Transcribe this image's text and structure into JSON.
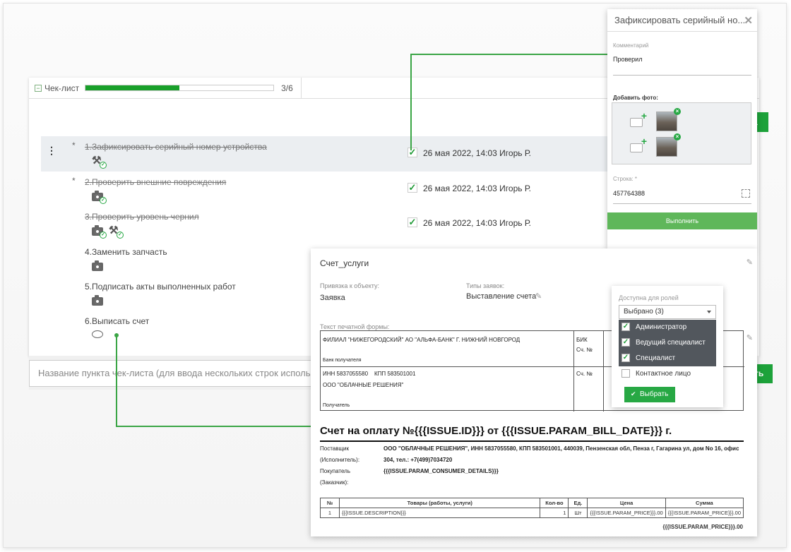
{
  "checklist": {
    "tab_label": "Чек-лист",
    "progress": 0.5,
    "count": "3/6",
    "items": [
      {
        "num": "1.",
        "title": "Зафиксировать серийный номер устройства",
        "done": true,
        "required": true,
        "meta": "26 мая 2022, 14:03 Игорь Р."
      },
      {
        "num": "2.",
        "title": "Проверить внешние повреждения",
        "done": true,
        "required": true,
        "meta": "26 мая 2022, 14:03 Игорь Р."
      },
      {
        "num": "3.",
        "title": "Проверить уровень чернил",
        "done": true,
        "required": false,
        "meta": "26 мая 2022, 14:03 Игорь Р."
      },
      {
        "num": "4.",
        "title": "Заменить запчасть",
        "done": false,
        "required": false,
        "meta": ""
      },
      {
        "num": "5.",
        "title": "Подписать акты выполненных работ",
        "done": false,
        "required": false,
        "meta": ""
      },
      {
        "num": "6.",
        "title": "Выписать счет",
        "done": false,
        "required": false,
        "meta": ""
      }
    ],
    "input_placeholder": "Название пункта чек-листа (для ввода нескольких строк используй",
    "add_button_partial": "ть",
    "top_button_partial": "а"
  },
  "popup_serial": {
    "title": "Зафиксировать серийный но...",
    "comment_label": "Комментарий",
    "comment_value": "Проверил",
    "photo_label": "Добавить фото:",
    "string_label": "Строка: *",
    "string_value": "457764388",
    "submit_label": "Выполнить"
  },
  "popup_invoice": {
    "title": "Счет_услуги",
    "object_label": "Привязка к объекту:",
    "object_value": "Заявка",
    "types_label": "Типы заявок:",
    "types_value": "Выставление счета",
    "print_label": "Текст печатной формы:",
    "bank_name": "ФИЛИАЛ \"НИЖЕГОРОДСКИЙ\" АО \"АЛЬФА-БАНК\" Г. НИЖНИЙ НОВГОРОД",
    "bank_recipient": "Банк получателя",
    "bik": "БИК",
    "acc": "Сч. №",
    "inn": "ИНН 5837055580",
    "kpp": "КПП 583501001",
    "org": "ООО \"ОБЛАЧНЫЕ РЕШЕНИЯ\"",
    "recipient": "Получатель",
    "acc2": "Сч. №",
    "invoice_title": "Счет на оплату №{{{ISSUE.ID}}} от {{{ISSUE.PARAM_BILL_DATE}}} г.",
    "supplier_label": "Поставщик",
    "supplier_label2": "(Исполнитель):",
    "supplier_value": "ООО \"ОБЛАЧНЫЕ РЕШЕНИЯ\", ИНН 5837055580, КПП 583501001, 440039, Пензенская обл, Пенза г, Гагарина ул, дом No 16, офис",
    "supplier_value2": "304, тел.: +7(499)7034720",
    "buyer_label": "Покупатель",
    "buyer_label2": "(Заказчик):",
    "buyer_value": "{{{ISSUE.PARAM_CONSUMER_DETAILS}}}",
    "table_headers": [
      "№",
      "Товары (работы, услуги)",
      "Кол-во",
      "Ед.",
      "Цена",
      "Сумма"
    ],
    "table_row": [
      "1",
      "{{{ISSUE.DESCRIPTION}}}",
      "1",
      "Шт",
      "{{{ISSUE.PARAM_PRICE}}}.00",
      "{{{ISSUE.PARAM_PRICE}}}.00"
    ],
    "total": "{{{ISSUE.PARAM_PRICE}}}.00"
  },
  "roles_dropdown": {
    "label": "Доступна для ролей",
    "selected": "Выбрано (3)",
    "options": [
      {
        "label": "Администратор",
        "checked": true
      },
      {
        "label": "Ведущий специалист",
        "checked": true
      },
      {
        "label": "Специалист",
        "checked": true
      },
      {
        "label": "Контактное лицо",
        "checked": false
      }
    ],
    "button": "Выбрать"
  },
  "colors": {
    "accent_green": "#1da23a",
    "connector": "#3aa545",
    "highlight_row": "#ebeef1"
  }
}
